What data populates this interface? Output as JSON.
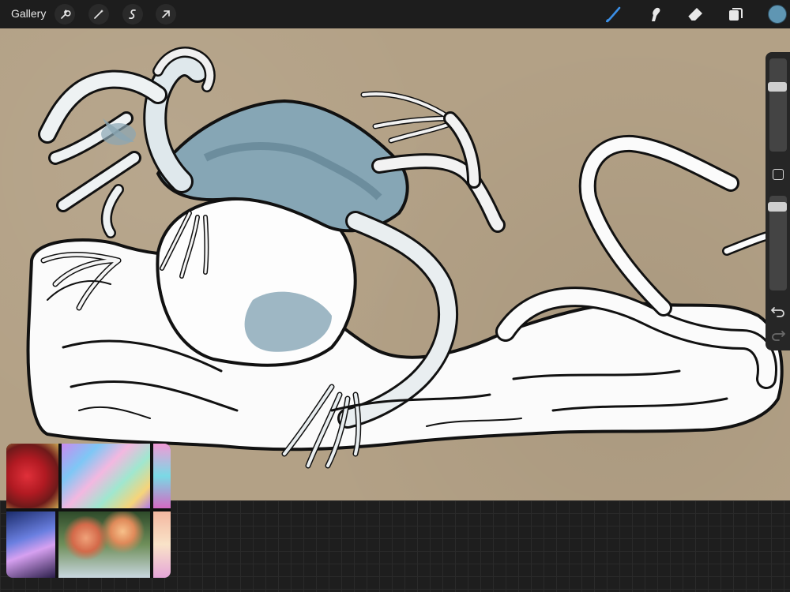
{
  "topbar": {
    "gallery_label": "Gallery",
    "left_tools": [
      "wrench-icon",
      "magic-wand-icon",
      "selection-icon",
      "transform-arrow-icon"
    ],
    "right_tools": [
      "brush-icon",
      "smudge-icon",
      "eraser-icon",
      "layers-icon"
    ],
    "active_tool": "brush-icon",
    "active_color": "#5f96b3"
  },
  "canvas": {
    "paper_color": "#b3a186"
  },
  "sidebar": {
    "brush_size": 0.72,
    "opacity": 0.93
  },
  "reference_window": {
    "visible": true
  }
}
